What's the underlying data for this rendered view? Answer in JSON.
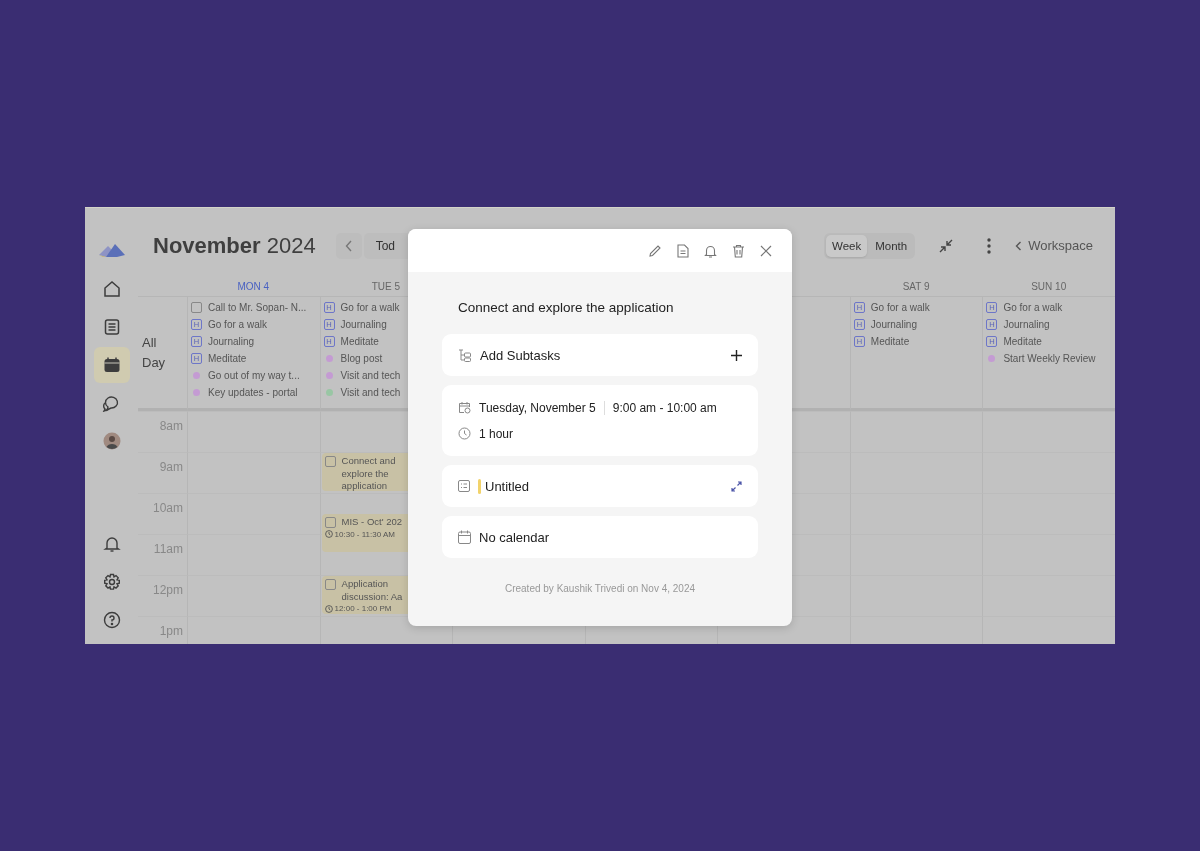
{
  "sidebar": {
    "top_items": [
      {
        "kind": "home",
        "selected": false
      },
      {
        "kind": "notes",
        "selected": false
      },
      {
        "kind": "calendar",
        "selected": true
      },
      {
        "kind": "chat",
        "selected": false
      },
      {
        "kind": "avatar",
        "selected": false
      }
    ],
    "bottom_items": [
      {
        "kind": "bell",
        "selected": false
      },
      {
        "kind": "settings",
        "selected": false
      },
      {
        "kind": "help",
        "selected": false
      }
    ]
  },
  "header": {
    "month": "November",
    "year": "2024",
    "today_button": "Tod",
    "view_toggle": [
      {
        "label": "Week",
        "selected": true
      },
      {
        "label": "Month",
        "selected": false
      }
    ],
    "back_link": "Workspace"
  },
  "all_day_label": "All Day",
  "hours": [
    {
      "label": "8am"
    },
    {
      "label": "9am",
      "events": [
        {
          "kind": "tue",
          "title": "Connect and explore the application",
          "checked": false,
          "half_past": false
        }
      ]
    },
    {
      "label": "10am",
      "events": [
        {
          "kind": "tue",
          "title": "MIS - Oct' 202",
          "time": "10:30 - 11:30 AM",
          "checked": false,
          "half_past": true
        }
      ]
    },
    {
      "label": "11am"
    },
    {
      "label": "12pm",
      "events": [
        {
          "kind": "tue",
          "title": "Application discussion: Aa",
          "time": "12:00 - 1:00 PM",
          "checked": false,
          "half_past": false
        }
      ]
    },
    {
      "label": "1pm"
    }
  ],
  "days": [
    {
      "kind": "mon",
      "label": "MON 4",
      "today": true,
      "all_day": [
        {
          "kind": "task",
          "text": "Call to Mr. Sopan- N...",
          "checked": false
        },
        {
          "kind": "habit",
          "badge": "H",
          "text": "Go for a walk"
        },
        {
          "kind": "habit",
          "badge": "H",
          "text": "Journaling"
        },
        {
          "kind": "habit",
          "badge": "H",
          "text": "Meditate"
        },
        {
          "kind": "event",
          "text": "Go out of my way t...",
          "color": "#c49bd3"
        },
        {
          "kind": "event",
          "text": "Key updates - portal",
          "color": "#c49bd3"
        }
      ]
    },
    {
      "kind": "tue",
      "label": "TUE 5",
      "today": false,
      "all_day": [
        {
          "kind": "habit",
          "badge": "H",
          "text": "Go for a walk"
        },
        {
          "kind": "habit",
          "badge": "H",
          "text": "Journaling"
        },
        {
          "kind": "habit",
          "badge": "H",
          "text": "Meditate"
        },
        {
          "kind": "event",
          "text": "Blog post",
          "color": "#c49bd3"
        },
        {
          "kind": "event",
          "text": "Visit and tech",
          "color": "#c49bd3"
        },
        {
          "kind": "event",
          "text": "Visit and tech",
          "color": "#99c6a4"
        }
      ]
    },
    {
      "kind": "sat",
      "label": "SAT 9",
      "today": false,
      "all_day": [
        {
          "kind": "habit",
          "badge": "H",
          "text": "Go for a walk"
        },
        {
          "kind": "habit",
          "badge": "H",
          "text": "Journaling"
        },
        {
          "kind": "habit",
          "badge": "H",
          "text": "Meditate"
        }
      ]
    },
    {
      "kind": "sun",
      "label": "SUN 10",
      "today": false,
      "all_day": [
        {
          "kind": "habit",
          "badge": "H",
          "text": "Go for a walk"
        },
        {
          "kind": "habit",
          "badge": "H",
          "text": "Journaling"
        },
        {
          "kind": "habit",
          "badge": "H",
          "text": "Meditate"
        },
        {
          "kind": "event",
          "text": "Start Weekly Review",
          "color": "#c49bd3"
        }
      ]
    }
  ],
  "modal": {
    "title": "Connect and explore the application",
    "subtasks_label": "Add Subtasks",
    "date": "Tuesday, November 5",
    "time_range": "9:00 am - 10:00 am",
    "duration": "1 hour",
    "note": {
      "title": "Untitled",
      "color": "#f2d36b"
    },
    "calendar": "No calendar",
    "footer": "Created by Kaushik Trivedi on Nov 4, 2024"
  }
}
